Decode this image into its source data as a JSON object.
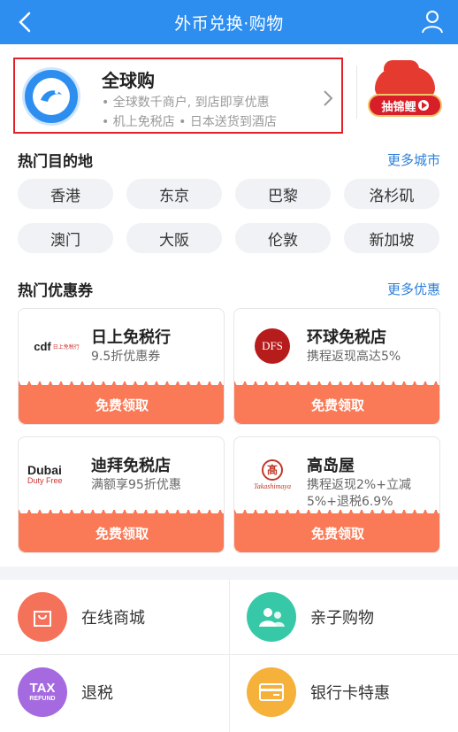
{
  "header": {
    "title": "外币兑换·购物"
  },
  "global": {
    "title": "全球购",
    "line1": "• 全球数千商户, 到店即享优惠",
    "line2": "• 机上免税店 • 日本送货到酒店",
    "promo_label": "抽锦鲤"
  },
  "destinations": {
    "title": "热门目的地",
    "more": "更多城市",
    "items": [
      "香港",
      "东京",
      "巴黎",
      "洛杉矶",
      "澳门",
      "大阪",
      "伦敦",
      "新加坡"
    ]
  },
  "coupons": {
    "title": "热门优惠券",
    "more": "更多优惠",
    "items": [
      {
        "brand": "cdf",
        "brand_sub": "日上免税行",
        "name": "日上免税行",
        "desc": "9.5折优惠券",
        "button": "免费领取"
      },
      {
        "brand": "DFS",
        "name": "环球免税店",
        "desc": "携程返现高达5%",
        "button": "免费领取"
      },
      {
        "brand": "Dubai",
        "brand_sub": "Duty Free",
        "name": "迪拜免税店",
        "desc": "满额享95折优惠",
        "button": "免费领取"
      },
      {
        "brand": "髙",
        "brand_sub": "Takashimaya",
        "name": "高岛屋",
        "desc": "携程返现2%+立减5%+退税6.9%",
        "button": "免费领取"
      }
    ]
  },
  "services": [
    {
      "label": "在线商城",
      "icon": "bag-icon",
      "color": "#f4725a"
    },
    {
      "label": "亲子购物",
      "icon": "family-icon",
      "color": "#37c9a7"
    },
    {
      "label": "退税",
      "icon": "tax-refund-icon",
      "icon_text": "TAX",
      "icon_sub": "REFUND",
      "color": "#a56ae0"
    },
    {
      "label": "银行卡特惠",
      "icon": "bank-card-icon",
      "color": "#f6b13a"
    }
  ]
}
